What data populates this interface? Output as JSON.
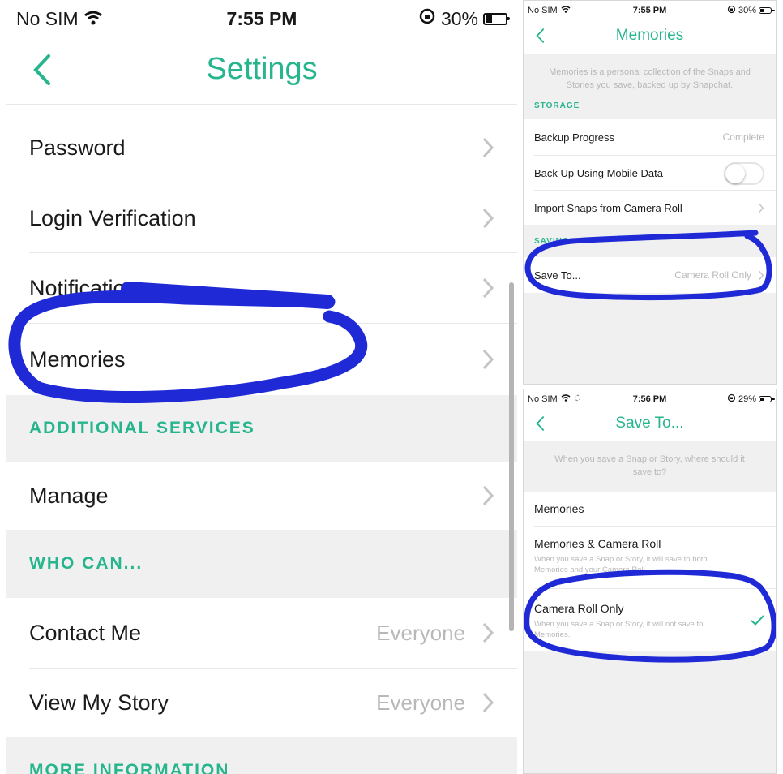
{
  "left": {
    "status": {
      "carrier": "No SIM",
      "time": "7:55 PM",
      "battery": "30%",
      "battery_level": 0.3
    },
    "nav": {
      "title": "Settings"
    },
    "rows": {
      "password": "Password",
      "login_verification": "Login Verification",
      "notifications": "Notifications",
      "memories": "Memories",
      "manage": "Manage",
      "contact_me": "Contact Me",
      "contact_me_value": "Everyone",
      "view_my_story": "View My Story",
      "view_my_story_value": "Everyone"
    },
    "sections": {
      "additional_services": "ADDITIONAL SERVICES",
      "who_can": "WHO CAN...",
      "more_information": "MORE INFORMATION"
    }
  },
  "top_right": {
    "status": {
      "carrier": "No SIM",
      "time": "7:55 PM",
      "battery": "30%",
      "battery_level": 0.3
    },
    "nav": {
      "title": "Memories"
    },
    "description": "Memories is a personal collection of the Snaps and Stories you save, backed up by Snapchat.",
    "section_storage": "STORAGE",
    "section_saving": "SAVING",
    "rows": {
      "backup_progress": "Backup Progress",
      "backup_progress_value": "Complete",
      "backup_mobile_data": "Back Up Using Mobile Data",
      "backup_mobile_data_on": false,
      "import_snaps": "Import Snaps from Camera Roll",
      "save_to": "Save To...",
      "save_to_value": "Camera Roll Only"
    }
  },
  "bottom_right": {
    "status": {
      "carrier": "No SIM",
      "time": "7:56 PM",
      "battery": "29%",
      "battery_level": 0.29
    },
    "nav": {
      "title": "Save To..."
    },
    "description": "When you save a Snap or Story, where should it save to?",
    "options": [
      {
        "title": "Memories",
        "subtitle": ""
      },
      {
        "title": "Memories & Camera Roll",
        "subtitle": "When you save a Snap or Story, it will save to both Memories and your Camera Roll."
      },
      {
        "title": "Camera Roll Only",
        "subtitle": "When you save a Snap or Story, it will not save to Memories."
      }
    ],
    "selected_option": "Camera Roll Only"
  },
  "colors": {
    "accent": "#27b58e",
    "ink": "#1f2ad6",
    "section_bg": "#f0f0f0"
  }
}
